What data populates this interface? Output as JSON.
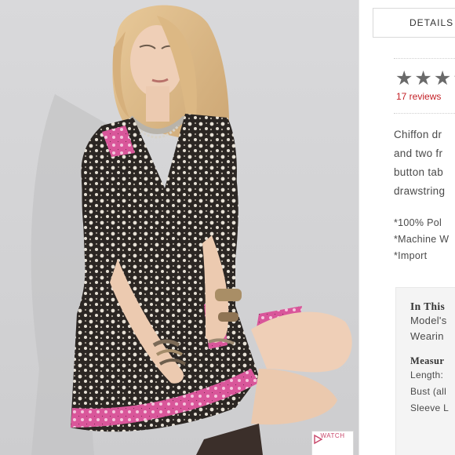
{
  "product_image": {
    "watch_label": "WATCH",
    "accent_color": "#d9569a",
    "play_icon": "play-triangle-icon"
  },
  "details_panel": {
    "tab_label": "DETAILS",
    "rating_stars": "★★★★★",
    "reviews_label": "17 reviews",
    "description_lines": [
      "Chiffon dr",
      "and two fr",
      "button tab",
      "drawstring"
    ],
    "spec_lines": [
      "*100% Pol",
      "*Machine W",
      "*Import"
    ],
    "fit": {
      "heading": "In This",
      "lines": [
        "Model's",
        "Wearin"
      ]
    },
    "measurements": {
      "heading": "Measur",
      "lines": [
        "Length:",
        "Bust (all",
        "Sleeve L"
      ]
    }
  }
}
